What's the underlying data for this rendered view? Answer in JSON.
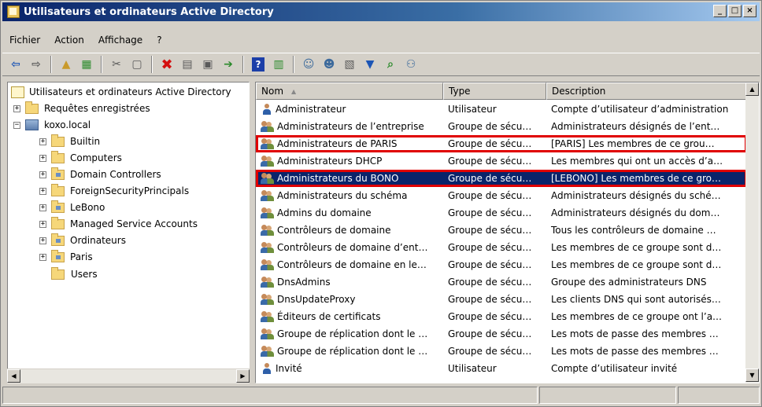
{
  "window": {
    "title": "Utilisateurs et ordinateurs Active Directory",
    "controls": [
      "_",
      "□",
      "×"
    ]
  },
  "menu": [
    {
      "label": "Fichier"
    },
    {
      "label": "Action"
    },
    {
      "label": "Affichage"
    },
    {
      "label": "?"
    }
  ],
  "toolbar": {
    "icons": [
      "back-icon",
      "forward-icon",
      "up-folder-icon",
      "console-tree-icon",
      "cut-icon",
      "copy-icon",
      "delete-icon",
      "properties-icon",
      "refresh-icon",
      "export-icon",
      "help-icon",
      "show-hide-icon",
      "new-user-icon",
      "new-group-icon",
      "new-ou-icon",
      "filter-icon",
      "find-icon",
      "add-to-group-icon"
    ]
  },
  "tree": {
    "root": "Utilisateurs et ordinateurs Active Directory",
    "items": [
      {
        "label": "Requêtes enregistrées",
        "expander": "+"
      },
      {
        "label": "koxo.local",
        "expander": "−"
      },
      {
        "label": "Builtin",
        "expander": "+"
      },
      {
        "label": "Computers",
        "expander": "+"
      },
      {
        "label": "Domain Controllers",
        "expander": "+"
      },
      {
        "label": "ForeignSecurityPrincipals",
        "expander": "+"
      },
      {
        "label": "LeBono",
        "expander": "+"
      },
      {
        "label": "Managed Service Accounts",
        "expander": "+"
      },
      {
        "label": "Ordinateurs",
        "expander": "+"
      },
      {
        "label": "Paris",
        "expander": "+"
      },
      {
        "label": "Users",
        "expander": ""
      }
    ]
  },
  "list": {
    "columns": [
      "Nom",
      "Type",
      "Description"
    ],
    "rows": [
      {
        "name": "Administrateur",
        "type": "Utilisateur",
        "desc": "Compte d’utilisateur d’administration",
        "icon": "user"
      },
      {
        "name": "Administrateurs de l’entreprise",
        "type": "Groupe de sécu…",
        "desc": "Administrateurs désignés de l’ent…",
        "icon": "group"
      },
      {
        "name": "Administrateurs de PARIS",
        "type": "Groupe de sécu…",
        "desc": "[PARIS] Les membres de ce grou…",
        "icon": "group"
      },
      {
        "name": "Administrateurs DHCP",
        "type": "Groupe de sécu…",
        "desc": "Les membres qui ont un accès d’a…",
        "icon": "group"
      },
      {
        "name": "Administrateurs du BONO",
        "type": "Groupe de sécu…",
        "desc": "[LEBONO] Les membres de ce gro…",
        "icon": "group"
      },
      {
        "name": "Administrateurs du schéma",
        "type": "Groupe de sécu…",
        "desc": "Administrateurs désignés du sché…",
        "icon": "group"
      },
      {
        "name": "Admins du domaine",
        "type": "Groupe de sécu…",
        "desc": "Administrateurs désignés du dom…",
        "icon": "group"
      },
      {
        "name": "Contrôleurs de domaine",
        "type": "Groupe de sécu…",
        "desc": "Tous les contrôleurs de domaine …",
        "icon": "group"
      },
      {
        "name": "Contrôleurs de domaine d’ent…",
        "type": "Groupe de sécu…",
        "desc": "Les membres de ce groupe sont d…",
        "icon": "group"
      },
      {
        "name": "Contrôleurs de domaine en le…",
        "type": "Groupe de sécu…",
        "desc": "Les membres de ce groupe sont d…",
        "icon": "group"
      },
      {
        "name": "DnsAdmins",
        "type": "Groupe de sécu…",
        "desc": "Groupe des administrateurs DNS",
        "icon": "group"
      },
      {
        "name": "DnsUpdateProxy",
        "type": "Groupe de sécu…",
        "desc": "Les clients DNS qui sont autorisés…",
        "icon": "group"
      },
      {
        "name": "Éditeurs de certificats",
        "type": "Groupe de sécu…",
        "desc": "Les membres de ce groupe ont l’a…",
        "icon": "group"
      },
      {
        "name": "Groupe de réplication dont le …",
        "type": "Groupe de sécu…",
        "desc": "Les mots de passe des membres …",
        "icon": "group"
      },
      {
        "name": "Groupe de réplication dont le …",
        "type": "Groupe de sécu…",
        "desc": "Les mots de passe des membres …",
        "icon": "group"
      },
      {
        "name": "Invité",
        "type": "Utilisateur",
        "desc": "Compte d’utilisateur invité",
        "icon": "user"
      }
    ]
  },
  "colors": {
    "titlebar": "#0a246a",
    "selection": "#0a246a",
    "highlight_box": "#e00000"
  }
}
